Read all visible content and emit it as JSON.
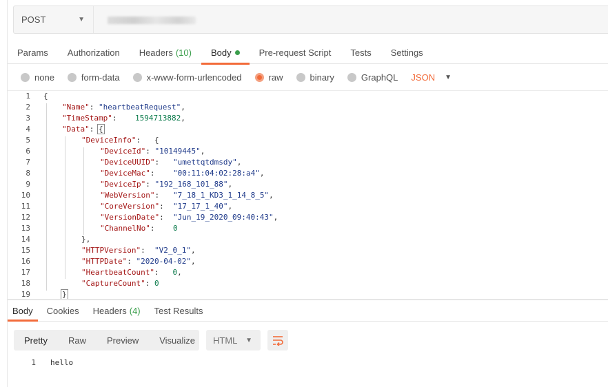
{
  "request": {
    "method": "POST",
    "url": ""
  },
  "request_tabs": [
    {
      "label": "Params"
    },
    {
      "label": "Authorization"
    },
    {
      "label": "Headers",
      "count": "(10)"
    },
    {
      "label": "Body",
      "active": true,
      "indicator": "green-dot"
    },
    {
      "label": "Pre-request Script"
    },
    {
      "label": "Tests"
    },
    {
      "label": "Settings"
    }
  ],
  "body_types": [
    {
      "label": "none",
      "selected": false
    },
    {
      "label": "form-data",
      "selected": false
    },
    {
      "label": "x-www-form-urlencoded",
      "selected": false
    },
    {
      "label": "raw",
      "selected": true
    },
    {
      "label": "binary",
      "selected": false
    },
    {
      "label": "GraphQL",
      "selected": false
    }
  ],
  "raw_format": "JSON",
  "editor_lines": [
    {
      "n": "1",
      "text": "{"
    },
    {
      "n": "2",
      "key": "\"Name\"",
      "sep": ": ",
      "value": "\"heartbeatRequest\"",
      "vtype": "str",
      "tail": ","
    },
    {
      "n": "3",
      "key": "\"TimeStamp\"",
      "sep": ":    ",
      "value": "1594713882",
      "vtype": "num",
      "tail": ","
    },
    {
      "n": "4",
      "key": "\"Data\"",
      "sep": ": ",
      "value": "{",
      "vtype": "bracket",
      "tail": ""
    },
    {
      "n": "5",
      "key": "\"DeviceInfo\"",
      "sep": ":   ",
      "value": "{",
      "vtype": "plain",
      "tail": ""
    },
    {
      "n": "6",
      "key": "\"DeviceId\"",
      "sep": ": ",
      "value": "\"10149445\"",
      "vtype": "str",
      "tail": ","
    },
    {
      "n": "7",
      "key": "\"DeviceUUID\"",
      "sep": ":   ",
      "value": "\"umettqtdmsdy\"",
      "vtype": "str",
      "tail": ","
    },
    {
      "n": "8",
      "key": "\"DeviceMac\"",
      "sep": ":    ",
      "value": "\"00:11:04:02:28:a4\"",
      "vtype": "str",
      "tail": ","
    },
    {
      "n": "9",
      "key": "\"DeviceIp\"",
      "sep": ": ",
      "value": "\"192_168_101_88\"",
      "vtype": "str",
      "tail": ","
    },
    {
      "n": "10",
      "key": "\"WebVersion\"",
      "sep": ":   ",
      "value": "\"7_18_1_KD3_1_14_8_5\"",
      "vtype": "str",
      "tail": ","
    },
    {
      "n": "11",
      "key": "\"CoreVersion\"",
      "sep": ":  ",
      "value": "\"17_17_1_40\"",
      "vtype": "str",
      "tail": ","
    },
    {
      "n": "12",
      "key": "\"VersionDate\"",
      "sep": ":  ",
      "value": "\"Jun_19_2020_09:40:43\"",
      "vtype": "str",
      "tail": ","
    },
    {
      "n": "13",
      "key": "\"ChannelNo\"",
      "sep": ":    ",
      "value": "0",
      "vtype": "num",
      "tail": ""
    },
    {
      "n": "14",
      "text": "},"
    },
    {
      "n": "15",
      "key": "\"HTTPVersion\"",
      "sep": ":  ",
      "value": "\"V2_0_1\"",
      "vtype": "str",
      "tail": ","
    },
    {
      "n": "16",
      "key": "\"HTTPDate\"",
      "sep": ": ",
      "value": "\"2020-04-02\"",
      "vtype": "str",
      "tail": ","
    },
    {
      "n": "17",
      "key": "\"HeartbeatCount\"",
      "sep": ":   ",
      "value": "0",
      "vtype": "num",
      "tail": ","
    },
    {
      "n": "18",
      "key": "\"CaptureCount\"",
      "sep": ": ",
      "value": "0",
      "vtype": "num",
      "tail": ""
    },
    {
      "n": "19",
      "text": "}",
      "boxed": true
    }
  ],
  "response_tabs": [
    {
      "label": "Body",
      "active": true
    },
    {
      "label": "Cookies"
    },
    {
      "label": "Headers",
      "count": "(4)"
    },
    {
      "label": "Test Results"
    }
  ],
  "view_modes": [
    "Pretty",
    "Raw",
    "Preview",
    "Visualize"
  ],
  "response_format": "HTML",
  "response_lines": [
    {
      "n": "1",
      "text": "hello"
    }
  ],
  "icons": {
    "method_caret": "chevron-down-icon",
    "format_caret": "chevron-down-icon",
    "wrap": "wrap-lines-icon"
  },
  "colors": {
    "accent": "#f26b3a",
    "success": "#3b9e4c"
  }
}
